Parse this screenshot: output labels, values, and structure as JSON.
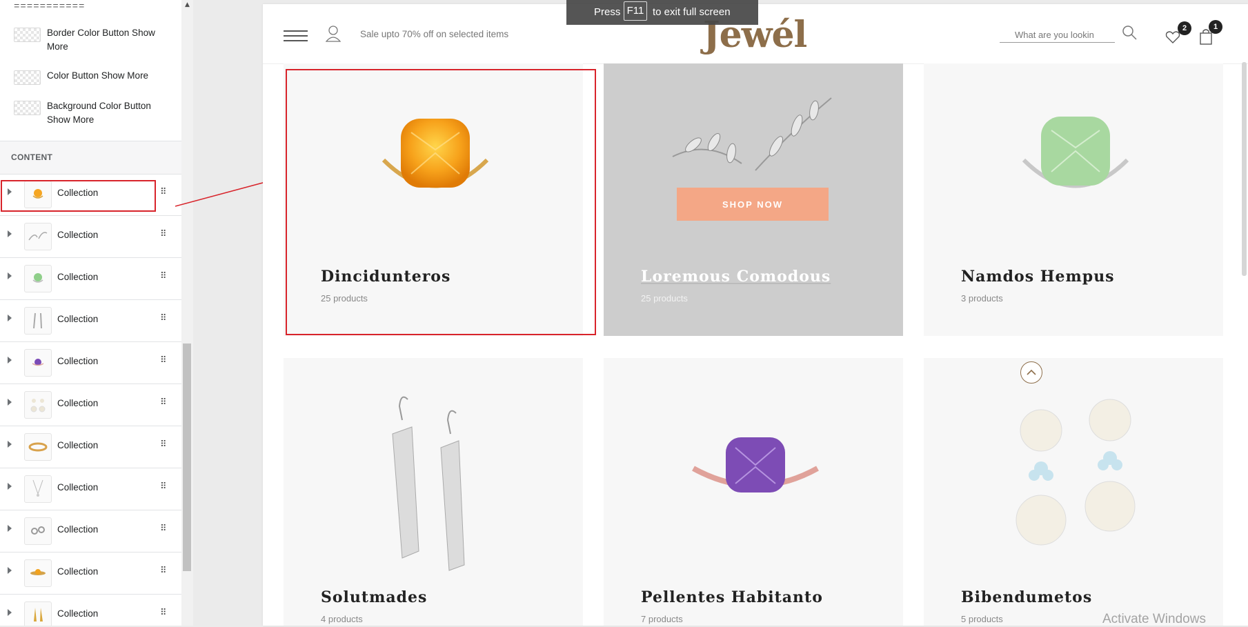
{
  "sidebar": {
    "divider_text": "===========",
    "settings": [
      {
        "label": "Border Color Button Show More"
      },
      {
        "label": "Color Button Show More"
      },
      {
        "label": "Background Color Button Show More"
      }
    ],
    "content_heading": "CONTENT",
    "collections": [
      {
        "label": "Collection",
        "thumb": "orange-ring"
      },
      {
        "label": "Collection",
        "thumb": "silver-leaves"
      },
      {
        "label": "Collection",
        "thumb": "green-ring"
      },
      {
        "label": "Collection",
        "thumb": "mesh-earrings"
      },
      {
        "label": "Collection",
        "thumb": "purple-ring"
      },
      {
        "label": "Collection",
        "thumb": "pearl-earrings"
      },
      {
        "label": "Collection",
        "thumb": "gold-band"
      },
      {
        "label": "Collection",
        "thumb": "pendant-necklace"
      },
      {
        "label": "Collection",
        "thumb": "stud-earrings"
      },
      {
        "label": "Collection",
        "thumb": "yellow-ring"
      },
      {
        "label": "Collection",
        "thumb": "gold-drop-earrings"
      }
    ]
  },
  "store": {
    "promo": "Sale upto 70% off on selected items",
    "logo": "Jewél",
    "search_placeholder": "What are you lookin",
    "wishlist_count": "2",
    "cart_count": "1"
  },
  "cards": [
    {
      "title": "Dincidunteros",
      "count": "25 products"
    },
    {
      "title": "Loremous Comodous",
      "count": "25 products",
      "button": "SHOP NOW"
    },
    {
      "title": "Namdos Hempus",
      "count": "3 products"
    },
    {
      "title": "Solutmades",
      "count": "4 products"
    },
    {
      "title": "Pellentes Habitanto",
      "count": "7 products"
    },
    {
      "title": "Bibendumetos",
      "count": "5 products"
    }
  ],
  "fullscreen_notice": {
    "press": "Press",
    "key": "F11",
    "rest": "to exit full screen"
  },
  "watermark": "Activate Windows",
  "colors": {
    "accent_red": "#d8232a",
    "brand_gold": "#8d6e4a",
    "shop_now": "#f4a786",
    "grey_card": "#cdcdcd"
  }
}
